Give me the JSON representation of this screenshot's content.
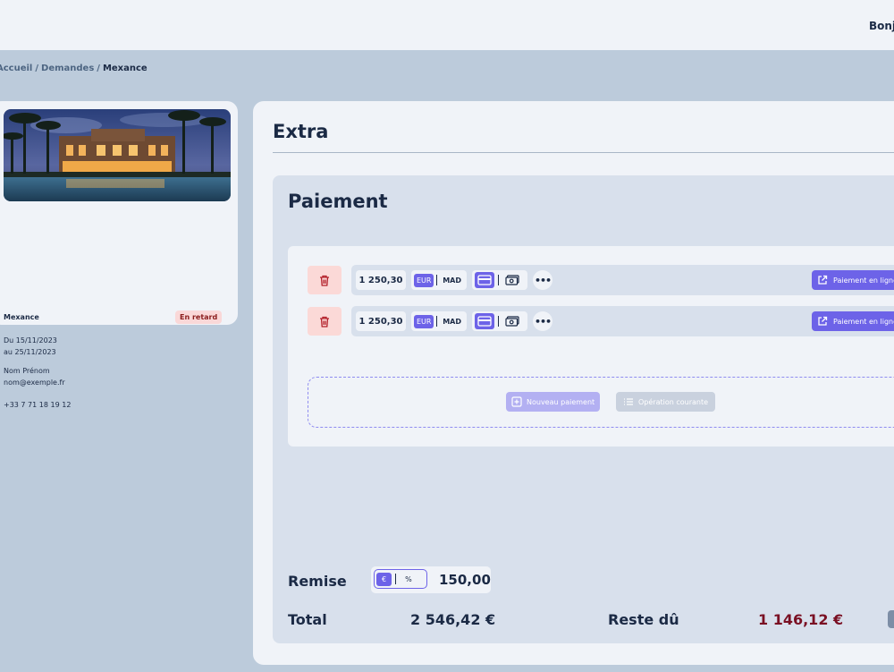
{
  "header": {
    "greeting": "Bonjo"
  },
  "breadcrumb": {
    "items": [
      "Accueil",
      "Demandes",
      "Mexance"
    ],
    "separator": "/"
  },
  "property_card": {
    "name": "Mexance",
    "status_badge": "En retard",
    "date_from": "Du 15/11/2023",
    "date_to": "au 25/11/2023",
    "contact_name": "Nom Prénom",
    "email": "nom@exemple.fr",
    "phone": "+33 7 71 18 19 12"
  },
  "main": {
    "title": "Extra",
    "payment_section": {
      "title": "Paiement",
      "rows": [
        {
          "amount": "1 250,30",
          "currency_options": [
            "EUR",
            "MAD"
          ],
          "selected_currency": "EUR",
          "selected_method": "card",
          "online_label": "Paiement en ligne"
        },
        {
          "amount": "1 250,30",
          "currency_options": [
            "EUR",
            "MAD"
          ],
          "selected_currency": "EUR",
          "selected_method": "card",
          "online_label": "Paiement en ligne"
        }
      ],
      "new_payment_label": "Nouveau paiement",
      "current_operation_label": "Opération courante"
    },
    "discount": {
      "label": "Remise",
      "mode_options": [
        "€",
        "%"
      ],
      "selected_mode": "€",
      "value": "150,00"
    },
    "totals": {
      "total_label": "Total",
      "total_value": "2 546,42 €",
      "remaining_label": "Reste dû",
      "remaining_value": "1 146,12 €"
    }
  },
  "colors": {
    "accent": "#6d63e8",
    "background": "#bccbdb",
    "danger_text": "#7a1023",
    "badge_bg": "#fad8d8"
  }
}
